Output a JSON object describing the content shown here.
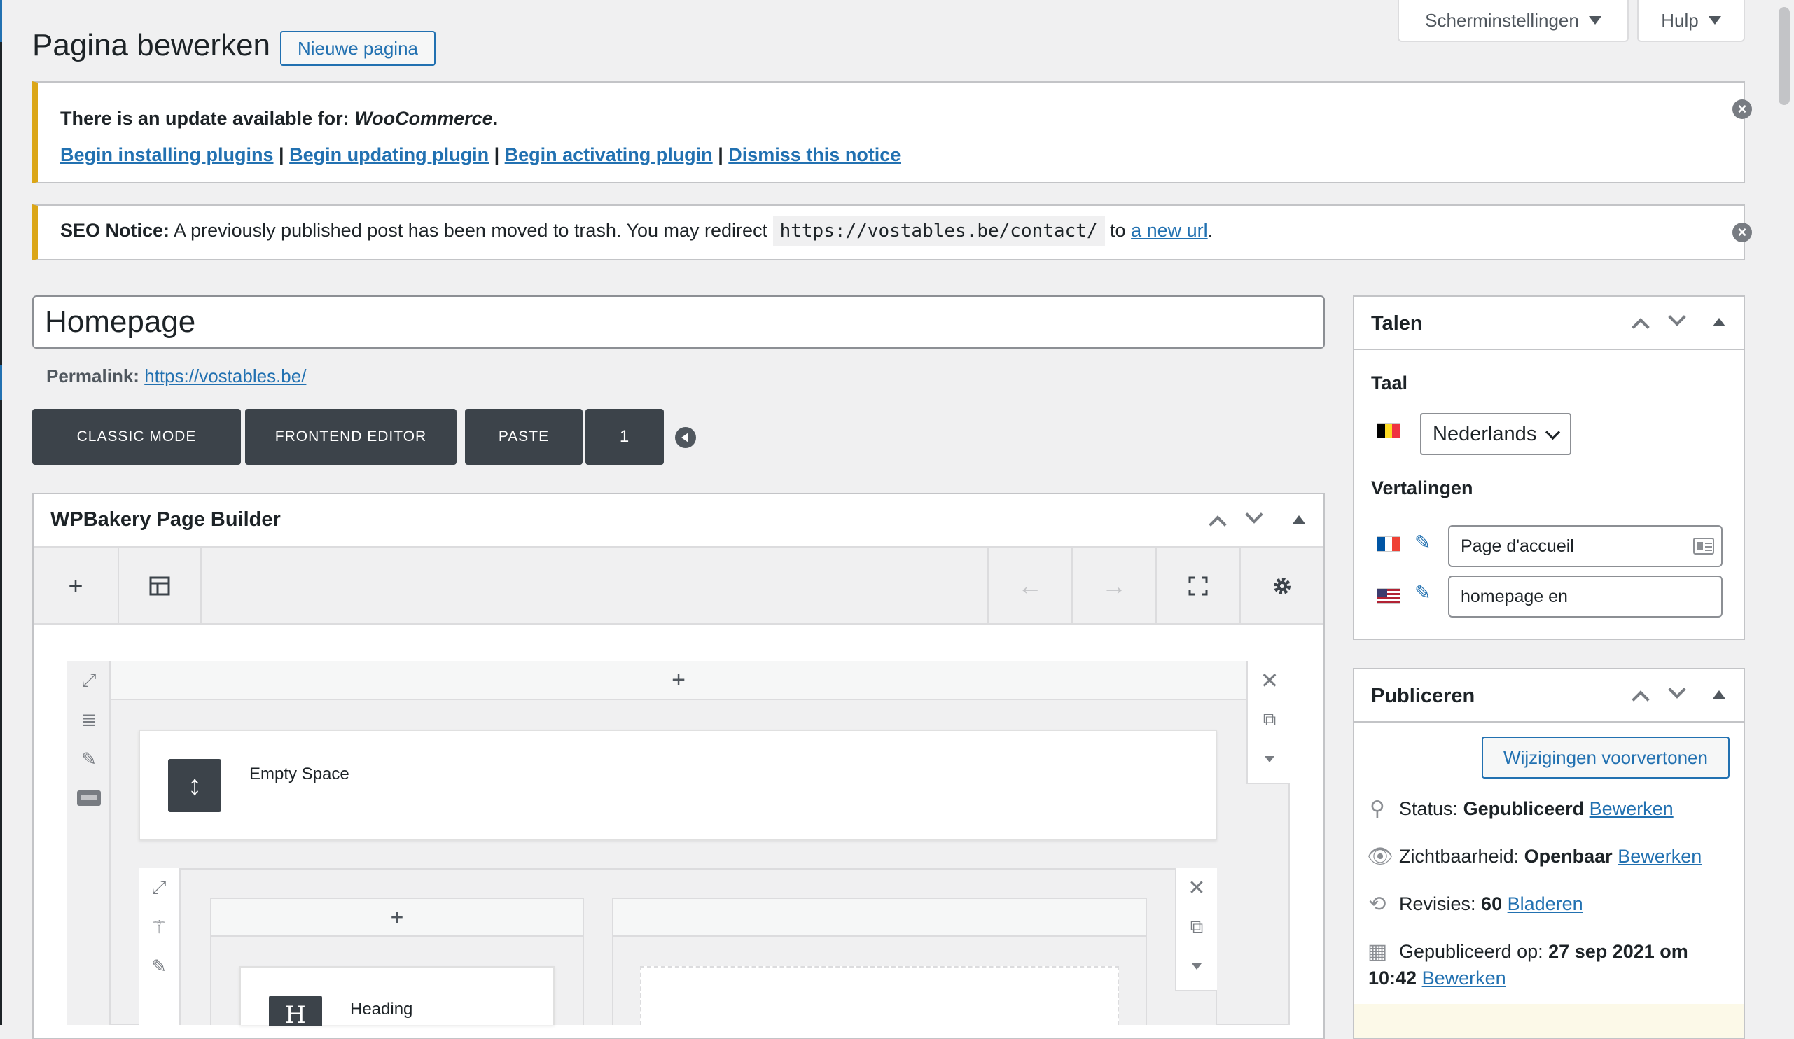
{
  "header": {
    "page_title": "Pagina bewerken",
    "new_page_button": "Nieuwe pagina",
    "screen_options": "Scherminstellingen",
    "help": "Hulp"
  },
  "notices": {
    "update": {
      "prefix": "There is an update available for:",
      "plugin": "WooCommerce",
      "suffix": ".",
      "links": [
        "Begin installing plugins",
        "Begin updating plugin",
        "Begin activating plugin",
        "Dismiss this notice"
      ],
      "separator": "|"
    },
    "seo": {
      "label": "SEO Notice:",
      "text": "A previously published post has been moved to trash. You may redirect",
      "url": "https://vostables.be/contact/",
      "to": "to",
      "link": "a new url",
      "end": "."
    }
  },
  "editor": {
    "title_value": "Homepage",
    "permalink_label": "Permalink:",
    "permalink_url": "https://vostables.be/",
    "buttons": [
      "CLASSIC MODE",
      "FRONTEND EDITOR",
      "PASTE",
      "1"
    ]
  },
  "wpbakery": {
    "title": "WPBakery Page Builder",
    "toolbar_icons": [
      "plus-icon",
      "layout-icon",
      "undo-icon",
      "redo-icon",
      "fullscreen-icon",
      "gear-icon"
    ],
    "elements": {
      "empty_space": "Empty Space",
      "heading": "Heading",
      "heading_icon_letter": "H"
    }
  },
  "languages": {
    "title": "Talen",
    "taal_label": "Taal",
    "selected_language": "Nederlands",
    "translations_label": "Vertalingen",
    "translations": [
      {
        "flag": "fr",
        "value": "Page d'accueil"
      },
      {
        "flag": "us",
        "value": "homepage en"
      }
    ]
  },
  "publish": {
    "title": "Publiceren",
    "preview_button": "Wijzigingen voorvertonen",
    "status_label": "Status:",
    "status_value": "Gepubliceerd",
    "visibility_label": "Zichtbaarheid:",
    "visibility_value": "Openbaar",
    "revisions_label": "Revisies:",
    "revisions_value": "60",
    "revisions_link": "Bladeren",
    "published_label": "Gepubliceerd op:",
    "published_value_1": "27 sep 2021 om",
    "published_value_2": "10:42",
    "edit_link": "Bewerken"
  }
}
